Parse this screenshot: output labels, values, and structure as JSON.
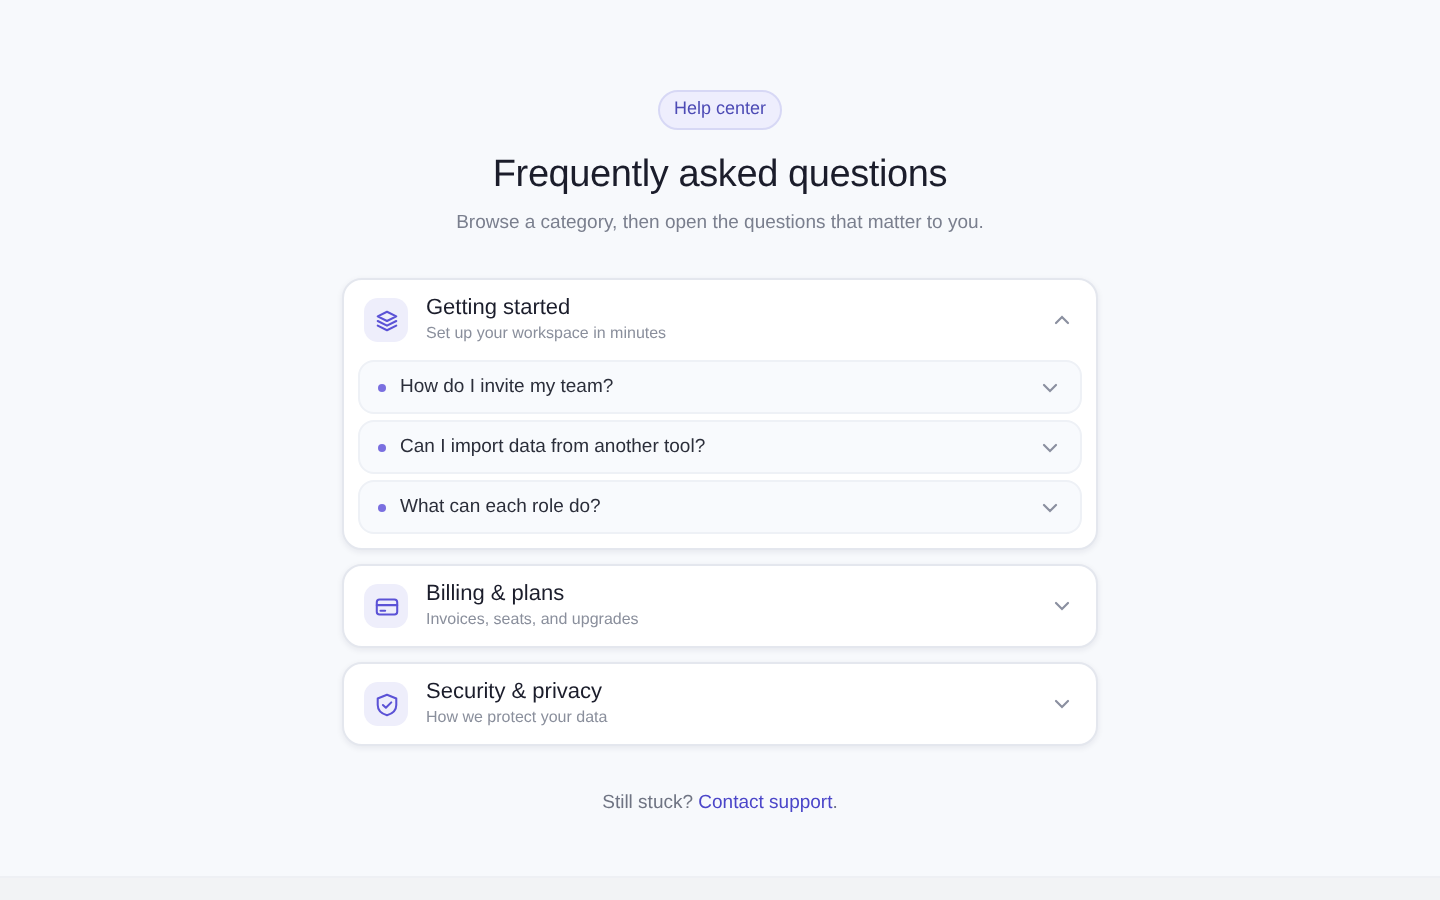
{
  "badge": "Help center",
  "title": "Frequently asked questions",
  "subtitle": "Browse a category, then open the questions that matter to you.",
  "categories": [
    {
      "kind": "layers",
      "title": "Getting started",
      "subtitle": "Set up your workspace in minutes",
      "expanded": true,
      "questions": [
        {
          "text": "How do I invite my team?",
          "expanded": false
        },
        {
          "text": "Can I import data from another tool?",
          "expanded": false
        },
        {
          "text": "What can each role do?",
          "expanded": false
        }
      ]
    },
    {
      "kind": "card",
      "title": "Billing & plans",
      "subtitle": "Invoices, seats, and upgrades",
      "expanded": false
    },
    {
      "kind": "shield",
      "title": "Security & privacy",
      "subtitle": "How we protect your data",
      "expanded": false
    }
  ],
  "footer": {
    "text": "Still stuck?",
    "link": "Contact support",
    "end": "."
  }
}
